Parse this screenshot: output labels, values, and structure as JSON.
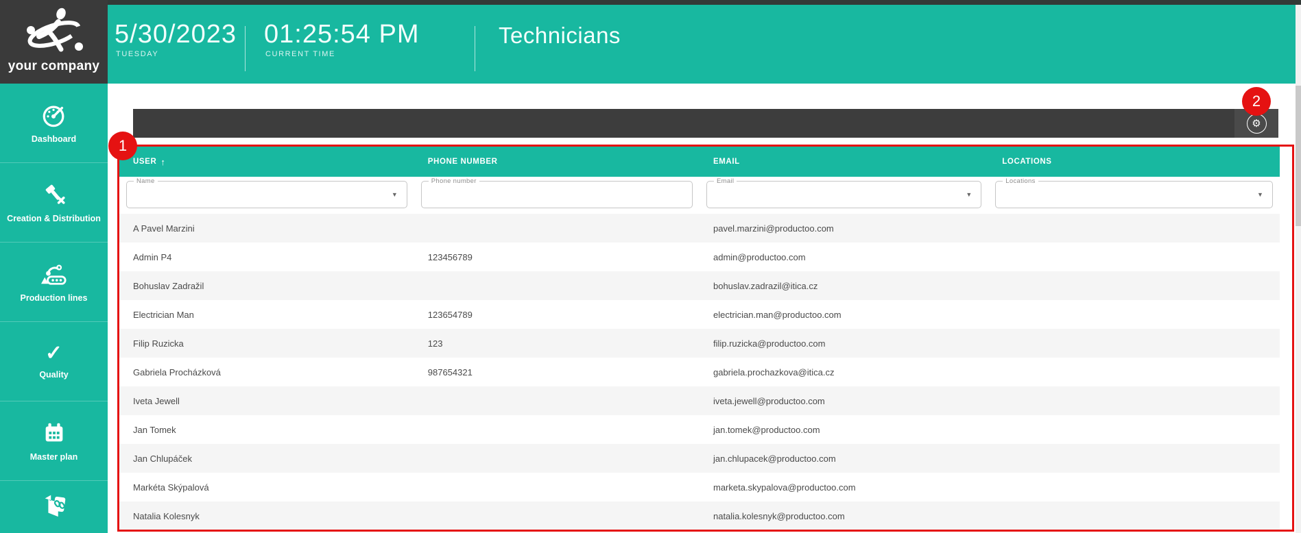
{
  "branding": {
    "company": "your company"
  },
  "topbar": {
    "date": "5/30/2023",
    "date_sublabel": "TUESDAY",
    "time": "01:25:54 PM",
    "time_sublabel": "CURRENT TIME",
    "page_title": "Technicians"
  },
  "sidebar": {
    "items": [
      {
        "label": "Dashboard",
        "icon": "gauge-icon"
      },
      {
        "label": "Creation & Distribution",
        "icon": "tools-icon"
      },
      {
        "label": "Production lines",
        "icon": "robot-arm-icon"
      },
      {
        "label": "Quality",
        "icon": "checkmark-icon"
      },
      {
        "label": "Master plan",
        "icon": "calendar-icon"
      },
      {
        "label": "",
        "icon": "handbook-icon"
      }
    ]
  },
  "icons": {
    "sort_asc": "↑",
    "dropdown": "▼",
    "gear": "⚙",
    "quality_check": "✓"
  },
  "annotations": {
    "badge_1": "1",
    "badge_2": "2"
  },
  "table": {
    "headers": {
      "user": "USER",
      "phone": "PHONE NUMBER",
      "email": "EMAIL",
      "locations": "LOCATIONS"
    },
    "filters": {
      "user": "Name",
      "phone": "Phone number",
      "email": "Email",
      "locations": "Locations"
    },
    "rows": [
      {
        "user": "A Pavel Marzini",
        "phone": "",
        "email": "pavel.marzini@productoo.com",
        "locations": ""
      },
      {
        "user": "Admin P4",
        "phone": "123456789",
        "email": "admin@productoo.com",
        "locations": ""
      },
      {
        "user": "Bohuslav Zadražil",
        "phone": "",
        "email": "bohuslav.zadrazil@itica.cz",
        "locations": ""
      },
      {
        "user": "Electrician Man",
        "phone": "123654789",
        "email": "electrician.man@productoo.com",
        "locations": ""
      },
      {
        "user": "Filip Ruzicka",
        "phone": "123",
        "email": "filip.ruzicka@productoo.com",
        "locations": ""
      },
      {
        "user": "Gabriela Procházková",
        "phone": "987654321",
        "email": "gabriela.prochazkova@itica.cz",
        "locations": ""
      },
      {
        "user": "Iveta Jewell",
        "phone": "",
        "email": "iveta.jewell@productoo.com",
        "locations": ""
      },
      {
        "user": "Jan Tomek",
        "phone": "",
        "email": "jan.tomek@productoo.com",
        "locations": ""
      },
      {
        "user": "Jan Chlupáček",
        "phone": "",
        "email": "jan.chlupacek@productoo.com",
        "locations": ""
      },
      {
        "user": "Markéta Skýpalová",
        "phone": "",
        "email": "marketa.skypalova@productoo.com",
        "locations": ""
      },
      {
        "user": "Natalia Kolesnyk",
        "phone": "",
        "email": "natalia.kolesnyk@productoo.com",
        "locations": ""
      }
    ]
  },
  "colors": {
    "accent_teal": "#18b8a0",
    "dark_panel": "#3a3a3a",
    "toolbar_dark": "#3d3d3d",
    "annotation_red": "#e51212",
    "row_stripe": "#f5f5f5"
  }
}
